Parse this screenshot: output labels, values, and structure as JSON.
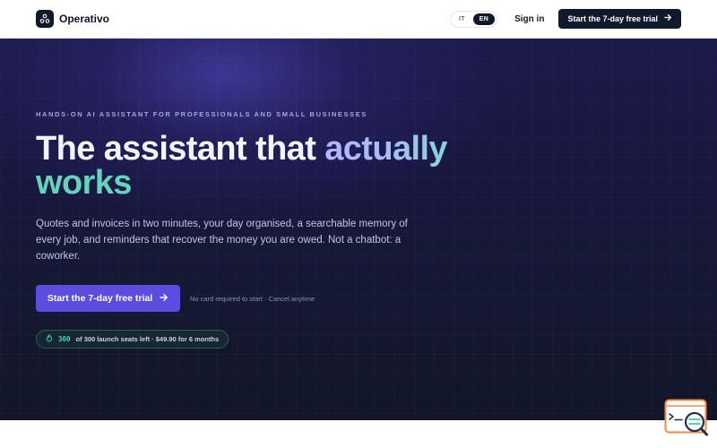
{
  "header": {
    "brand": "Operativo",
    "languages": [
      {
        "code": "IT",
        "active": false
      },
      {
        "code": "EN",
        "active": true
      }
    ],
    "sign_in": "Sign in",
    "trial_button": "Start the 7-day free trial"
  },
  "hero": {
    "eyebrow": "HANDS-ON AI ASSISTANT FOR PROFESSIONALS AND SMALL BUSINESSES",
    "headline_main": "The assistant that ",
    "headline_accent": "actually",
    "headline_green": "works",
    "lead": "Quotes and invoices in two minutes, your day organised, a searchable memory of every job, and reminders that recover the money you are owed. Not a chatbot: a coworker.",
    "cta": "Start the 7-day free trial",
    "cta_note": "No card required to start · Cancel anytime",
    "seats_count": "300",
    "seats_text": "of 300 launch seats left · $49.90 for 6 months"
  },
  "icons": {
    "logo": "triangle-logo-icon",
    "arrow": "arrow-right-icon",
    "seats": "flame-icon",
    "widget": "terminal-search-icon"
  },
  "colors": {
    "primary_cta": "#5a4de0",
    "header_cta": "#0f1a2d",
    "hero_bg": "#181740",
    "accent_green": "#63d3b9",
    "accent_teal": "#4fd0b0",
    "widget_orange": "#f08a4b"
  }
}
